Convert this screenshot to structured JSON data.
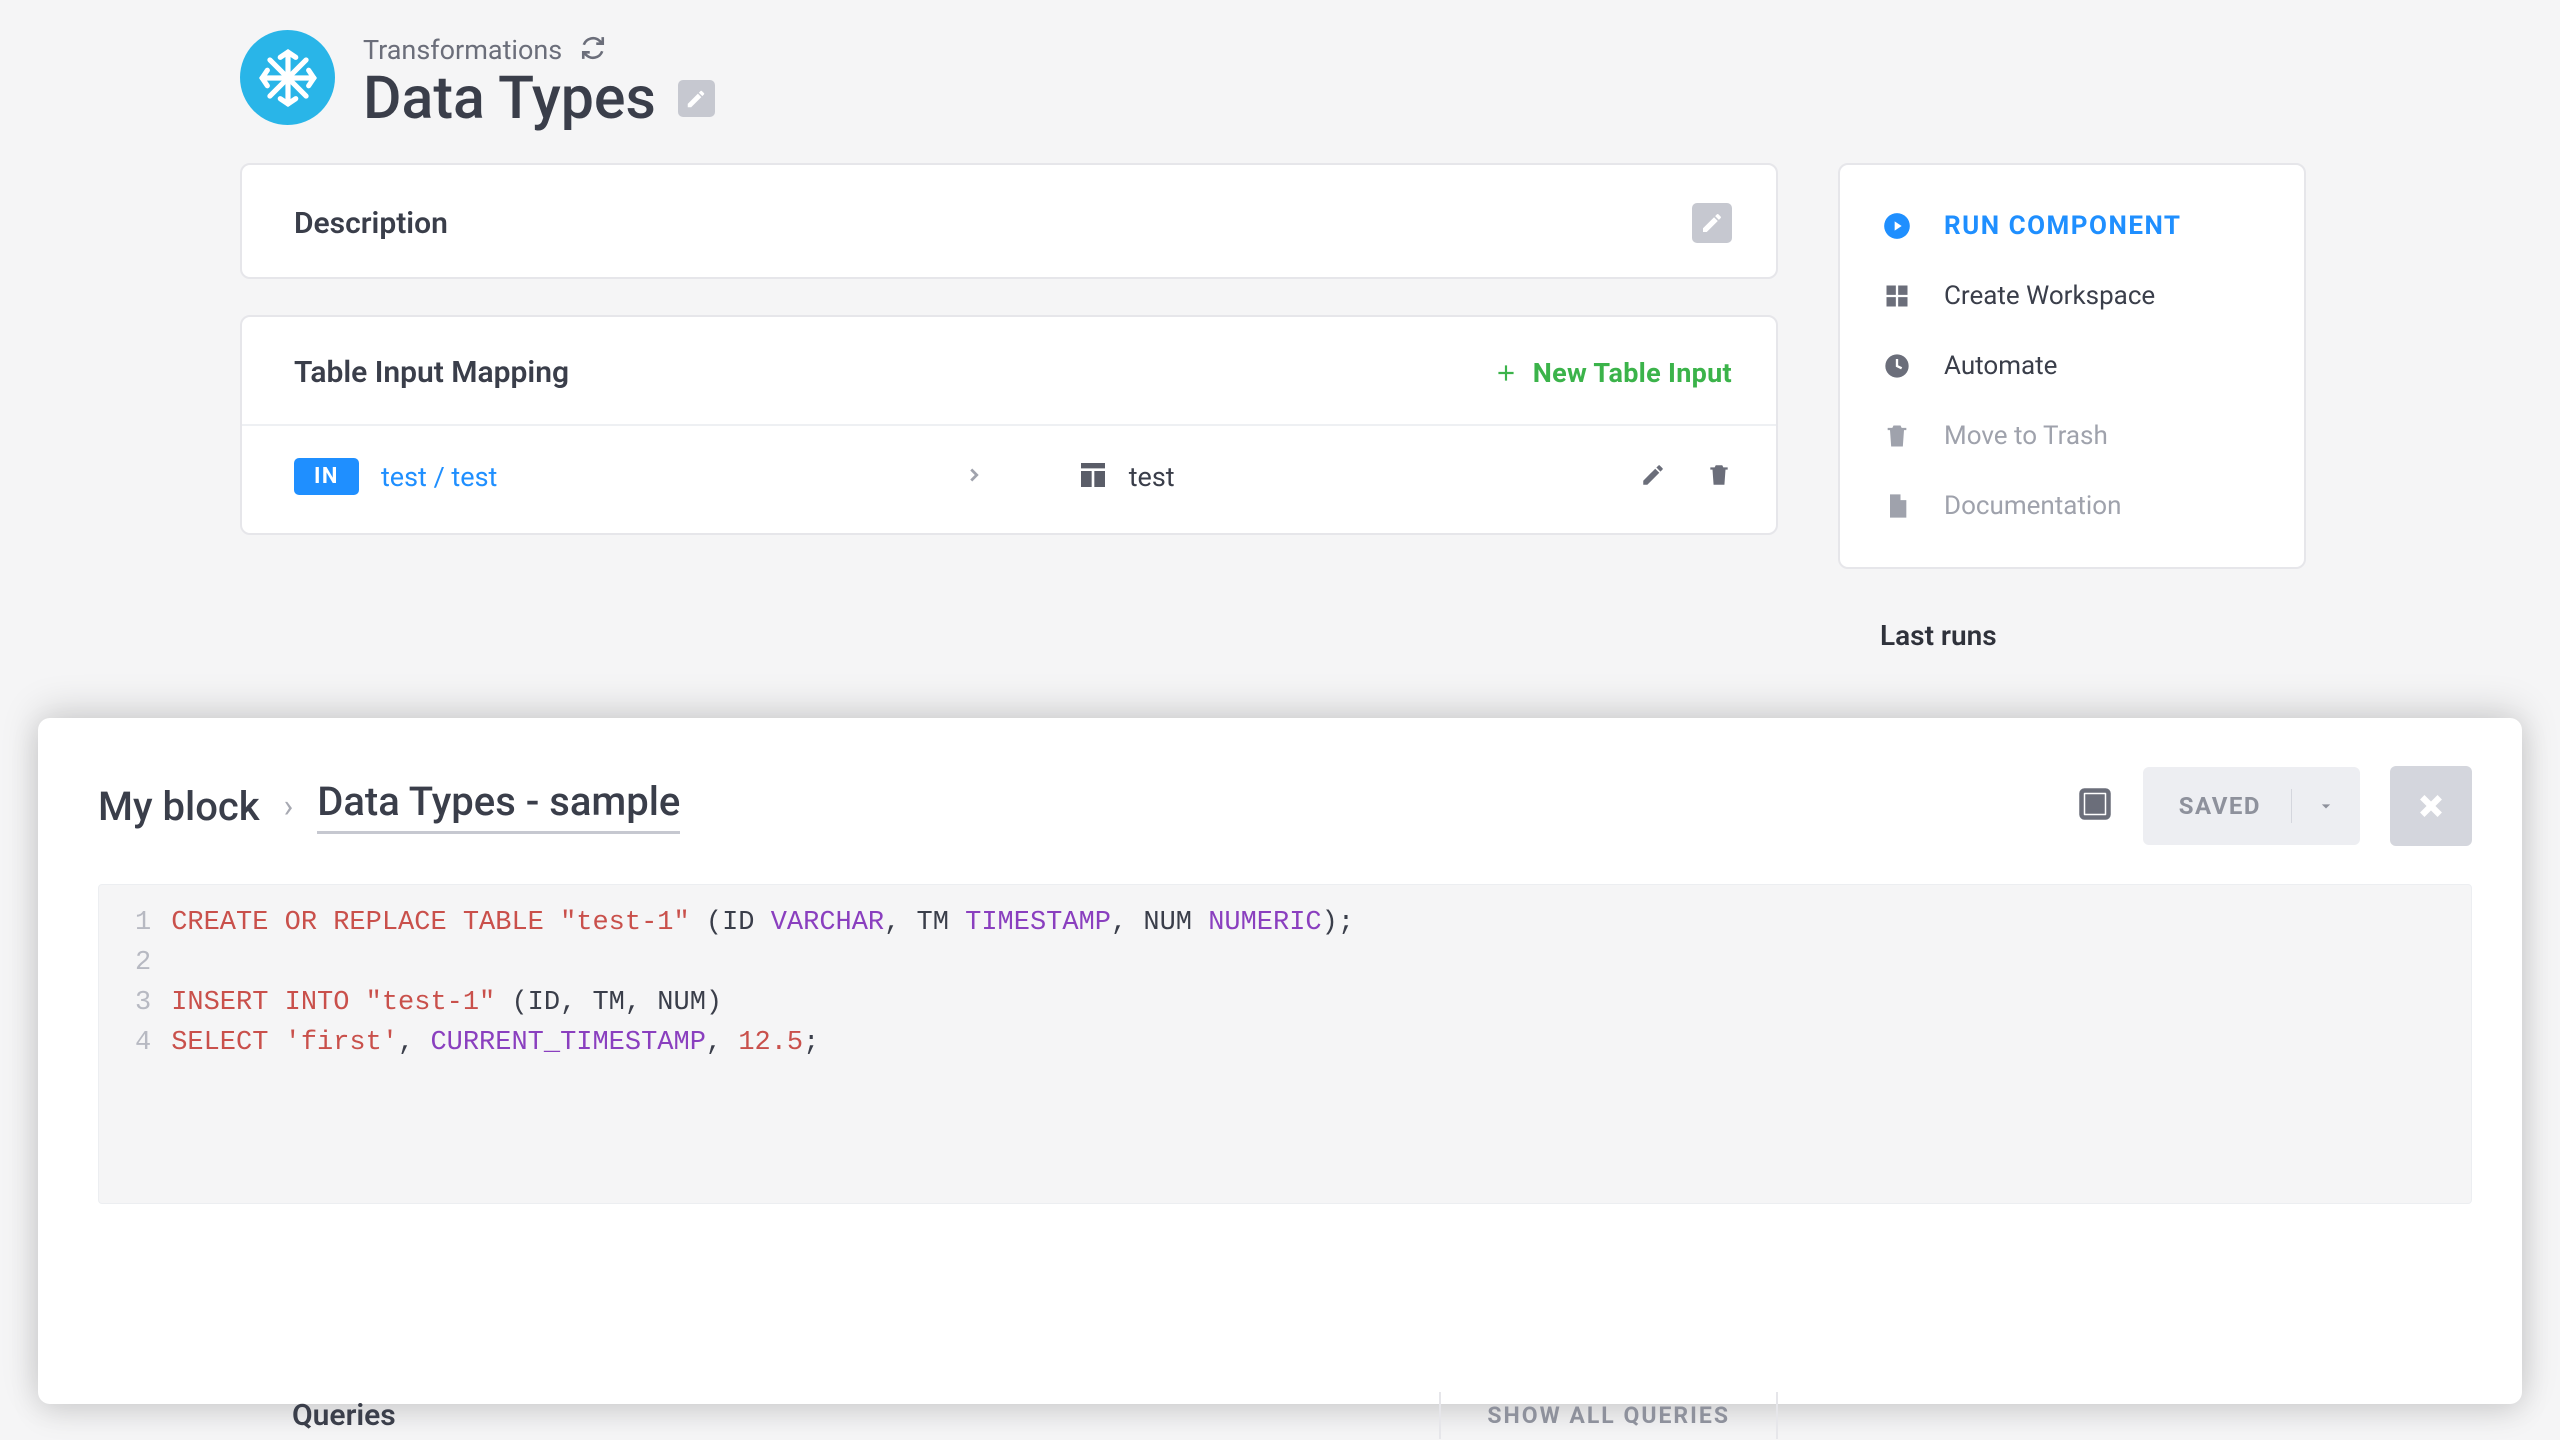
{
  "header": {
    "breadcrumb": "Transformations",
    "title": "Data Types"
  },
  "description_card": {
    "title": "Description"
  },
  "mapping_card": {
    "title": "Table Input Mapping",
    "new_btn": "New Table Input",
    "row": {
      "badge": "IN",
      "source": "test / test",
      "dest": "test"
    }
  },
  "actions": {
    "run": "RUN COMPONENT",
    "workspace": "Create Workspace",
    "automate": "Automate",
    "trash": "Move to Trash",
    "docs": "Documentation"
  },
  "last_runs_label": "Last runs",
  "editor": {
    "crumb": "My block",
    "title": "Data Types - sample",
    "saved": "SAVED",
    "code_lines": [
      "1",
      "2",
      "3",
      "4"
    ]
  },
  "sql": {
    "l1_a": "CREATE OR REPLACE TABLE",
    "l1_tbl": "\"test-1\"",
    "l1_b": " (ID ",
    "l1_t1": "VARCHAR",
    "l1_c": ", TM ",
    "l1_t2": "TIMESTAMP",
    "l1_d": ", NUM ",
    "l1_t3": "NUMERIC",
    "l1_e": ");",
    "l3_a": "INSERT INTO",
    "l3_tbl": "\"test-1\"",
    "l3_b": " (ID, TM, NUM)",
    "l4_a": "SELECT",
    "l4_str": "'first'",
    "l4_b": ", ",
    "l4_fn": "CURRENT_TIMESTAMP",
    "l4_c": ", ",
    "l4_num": "12.5",
    "l4_d": ";"
  },
  "queries": {
    "title": "Queries",
    "show_all": "SHOW ALL QUERIES"
  }
}
